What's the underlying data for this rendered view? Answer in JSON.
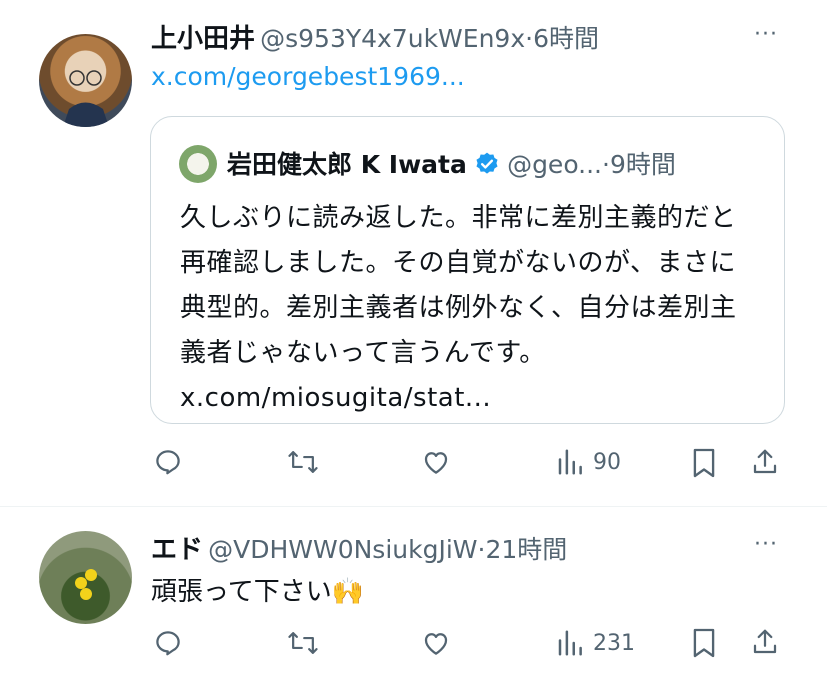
{
  "tweets": [
    {
      "display_name": "上小田井",
      "handle": "@s953Y4x7ukWEn9x",
      "sep": "·",
      "time": "6時間",
      "link": "x.com/georgebest1969...",
      "more": "···",
      "quote": {
        "display_name": "岩田健太郎 K Iwata",
        "handle": "@geo...",
        "sep": "·",
        "time": "9時間",
        "text": "久しぶりに読み返した。非常に差別主義的だと再確認しました。その自覚がないのが、まさに典型的。差別主義者は例外なく、自分は差別主義者じゃないって言うんです。 x.com/miosugita/stat..."
      },
      "actions": {
        "views": "90"
      }
    },
    {
      "display_name": "エド",
      "handle": "@VDHWW0NsiukgJiW",
      "sep": "·",
      "time": "21時間",
      "more": "···",
      "text": "頑張って下さい🙌",
      "actions": {
        "views": "231"
      }
    }
  ],
  "icons": {
    "reply": "reply-icon",
    "retweet": "retweet-icon",
    "like": "heart-icon",
    "views": "views-icon",
    "bookmark": "bookmark-icon",
    "share": "share-icon",
    "verified": "verified-badge-icon"
  },
  "colors": {
    "accent": "#1d9bf0",
    "muted": "#536471",
    "text": "#0f1419",
    "border": "#cfd9de"
  }
}
